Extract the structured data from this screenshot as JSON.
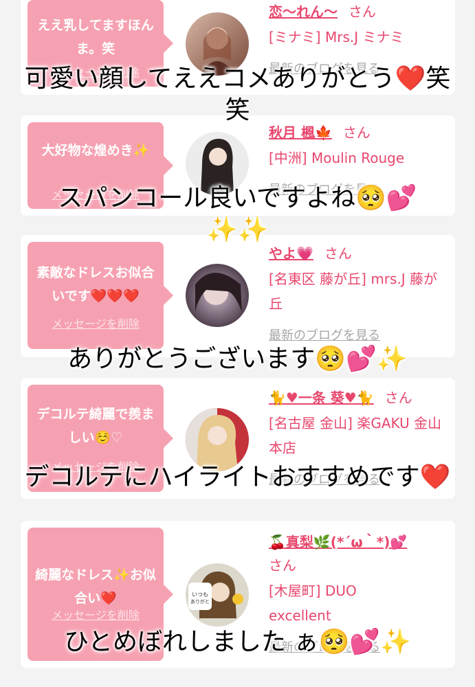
{
  "cards": [
    {
      "message": "ええ乳してますほんま。笑",
      "delete_label": "メッセージを削除",
      "name": "恋〜れん〜",
      "san": "さん",
      "shop": "[ミナミ] Mrs.J ミナミ",
      "blog": "最新のブログを見る"
    },
    {
      "message": "大好物な煌めき✨",
      "delete_label": "メッセージを削除",
      "name": "秋月 楓🍁",
      "san": "さん",
      "shop": "[中洲] Moulin Rouge",
      "blog": "最新のブログを見る"
    },
    {
      "message": "素敵なドレスお似合いです❤️❤️❤️",
      "delete_label": "メッセージを削除",
      "name": "やよ💗",
      "san": "さん",
      "shop": "[名東区 藤が丘] mrs.J 藤が丘",
      "blog": "最新のブログを見る"
    },
    {
      "message": "デコルテ綺麗で羨ましい☺️♡",
      "delete_label": "メッセージを削除",
      "name": "🐈♥一条 葵♥🐈",
      "san": "さん",
      "shop": "[名古屋 金山] 楽GAKU 金山本店",
      "blog": "最新のブログを見る"
    },
    {
      "message": "綺麗なドレス✨お似合い❤️",
      "delete_label": "メッセージを削除",
      "name": "🍒真梨🌿(*´ω｀*)💕",
      "san": "さん",
      "shop": "[木屋町] DUO excellent",
      "blog": "最新のブログを見る"
    }
  ],
  "captions": [
    "可愛い顔してええコメありがとう❤️笑笑",
    "スパンコール良いですよね🥺💕✨✨",
    "ありがとうございます🥺💕✨",
    "デコルテにハイライトおすすめです❤️",
    "ひとめぼれしました ぁ🥺💕✨"
  ],
  "colors": {
    "bubble": "#f6a1b1",
    "name": "#e8476d",
    "blog": "#a6a6a6",
    "page_bg": "#f3f3f3"
  },
  "avatar_icons": [
    "avatar-photo-1",
    "avatar-photo-2",
    "avatar-photo-3",
    "avatar-photo-4",
    "avatar-photo-5"
  ]
}
